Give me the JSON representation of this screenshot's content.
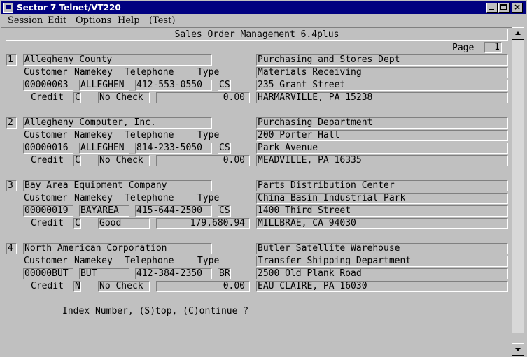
{
  "window": {
    "title": "Sector 7 Telnet/VT220"
  },
  "menu": [
    {
      "label": "Session",
      "key": "S"
    },
    {
      "label": "Edit",
      "key": "E"
    },
    {
      "label": "Options",
      "key": "O"
    },
    {
      "label": "Help",
      "key": "H"
    },
    {
      "label": "(Test)",
      "key": ""
    }
  ],
  "screen": {
    "header": "Sales Order Management 6.4plus",
    "page_label": "Page",
    "page_number": "1",
    "col_labels": {
      "customer": "Customer",
      "namekey": "Namekey",
      "telephone": "Telephone",
      "type": "Type",
      "credit": "Credit"
    },
    "records": [
      {
        "index": "1",
        "name": "Allegheny County",
        "customer": "00000003",
        "namekey": "ALLEGHEN",
        "telephone": "412-553-0550",
        "type": "CS",
        "credit_code": "C",
        "credit_status": "No Check",
        "amount": "0.00",
        "address": [
          "Purchasing and Stores Dept",
          "Materials Receiving",
          "235 Grant Street",
          "HARMARVILLE, PA 15238"
        ]
      },
      {
        "index": "2",
        "name": "Allegheny Computer, Inc.",
        "customer": "00000016",
        "namekey": "ALLEGHEN",
        "telephone": "814-233-5050",
        "type": "CS",
        "credit_code": "C",
        "credit_status": "No Check",
        "amount": "0.00",
        "address": [
          "Purchasing Department",
          "200 Porter Hall",
          "Park Avenue",
          "MEADVILLE, PA 16335"
        ]
      },
      {
        "index": "3",
        "name": "Bay Area Equipment Company",
        "customer": "00000019",
        "namekey": "BAYAREA",
        "telephone": "415-644-2500",
        "type": "CS",
        "credit_code": "C",
        "credit_status": "Good",
        "amount": "179,680.94",
        "address": [
          "Parts Distribution Center",
          "China Basin Industrial Park",
          "1400 Third Street",
          "MILLBRAE, CA 94030"
        ]
      },
      {
        "index": "4",
        "name": "North American Corporation",
        "customer": "00000BUT",
        "namekey": "BUT",
        "telephone": "412-384-2350",
        "type": "BR",
        "credit_code": "N",
        "credit_status": "No Check",
        "amount": "0.00",
        "address": [
          "Butler Satellite Warehouse",
          "Transfer Shipping Department",
          "2500 Old Plank Road",
          "EAU CLAIRE, PA 16030"
        ]
      }
    ],
    "prompt": "Index Number, (S)top, (C)ontinue ?"
  },
  "colors": {
    "titlebar": "#000080",
    "background": "#c0c0c0"
  }
}
